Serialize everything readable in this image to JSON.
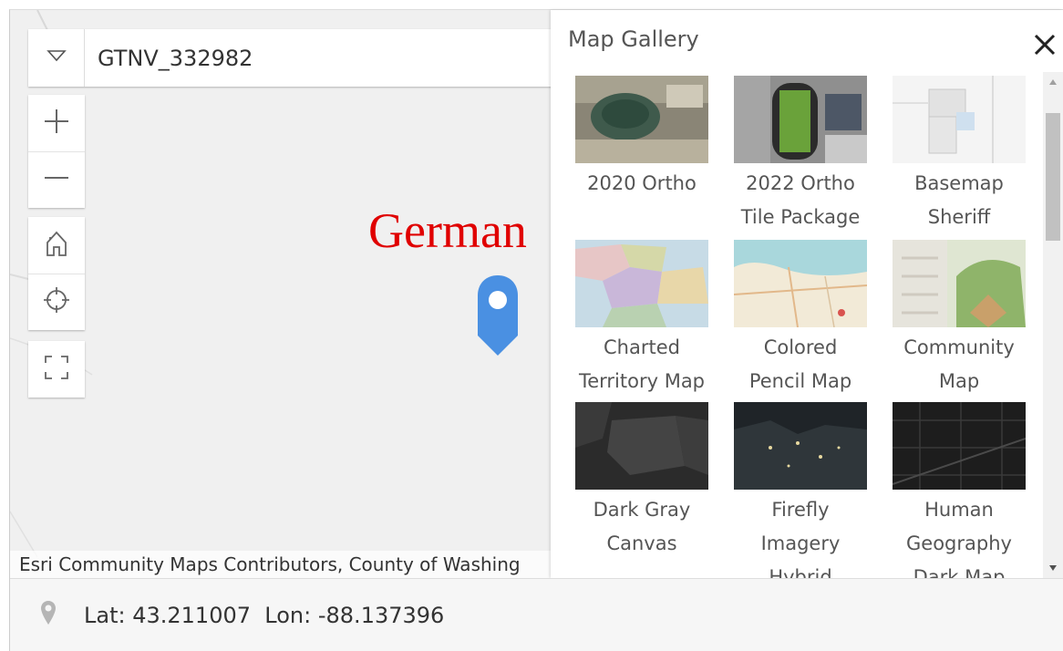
{
  "search": {
    "value": "GTNV_332982"
  },
  "map": {
    "place_label": "German",
    "attribution": "Esri Community Maps Contributors, County of Washing"
  },
  "gallery": {
    "title": "Map Gallery",
    "items": [
      {
        "line1": "2020 Ortho",
        "line2": ""
      },
      {
        "line1": "2022 Ortho",
        "line2": "Tile Package"
      },
      {
        "line1": "Basemap",
        "line2": "Sheriff"
      },
      {
        "line1": "Charted",
        "line2": "Territory Map"
      },
      {
        "line1": "Colored",
        "line2": "Pencil Map"
      },
      {
        "line1": "Community",
        "line2": "Map"
      },
      {
        "line1": "Dark Gray",
        "line2": "Canvas"
      },
      {
        "line1": "Firefly",
        "line2": "Imagery",
        "line3": "Hybrid"
      },
      {
        "line1": "Human",
        "line2": "Geography",
        "line3": "Dark Map"
      }
    ]
  },
  "coordinates": {
    "lat_label": "Lat:",
    "lat": "43.211007",
    "lon_label": "Lon:",
    "lon": "-88.137396"
  },
  "colors": {
    "accent": "#4a90e2",
    "label_red": "#e00000",
    "map_bg": "#f0f0f0"
  },
  "icons": [
    "chevron-down-icon",
    "zoom-in-icon",
    "zoom-out-icon",
    "home-icon",
    "locate-icon",
    "fullscreen-icon",
    "map-pin-icon",
    "close-icon"
  ]
}
